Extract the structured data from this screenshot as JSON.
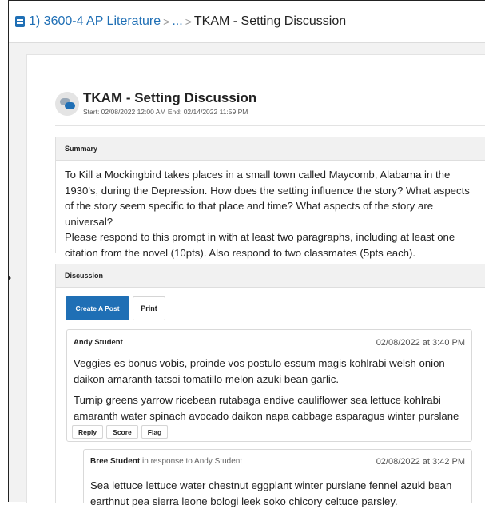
{
  "breadcrumb": {
    "course": "1) 3600-4 AP Literature",
    "separator": ">",
    "ellipsis": "...",
    "current": "TKAM - Setting Discussion"
  },
  "icons": {
    "course": "book-icon",
    "discussion": "chat-bubbles-icon"
  },
  "colors": {
    "accent": "#1f6fb5"
  },
  "topic": {
    "title": "TKAM - Setting Discussion",
    "dates": "Start: 02/08/2022 12:00 AM  End: 02/14/2022 11:59 PM"
  },
  "summary": {
    "heading": "Summary",
    "paragraph1": "To Kill a Mockingbird takes places in a small town called Maycomb, Alabama in the 1930's, during the Depression. How does the setting influence the story? What aspects of the story seem specific to that place and time? What aspects of the story are universal?",
    "paragraph2": "Please respond to this prompt in with at least two paragraphs, including at least one citation from the novel (10pts). Also respond to  two classmates (5pts each)."
  },
  "discussion": {
    "heading": "Discussion",
    "create_label": "Create A Post",
    "print_label": "Print"
  },
  "post": {
    "author": "Andy Student",
    "timestamp": "02/08/2022 at 3:40 PM",
    "paragraph1": "Veggies es bonus vobis, proinde vos postulo essum magis kohlrabi welsh onion daikon amaranth tatsoi tomatillo melon azuki bean garlic.",
    "paragraph2": "Turnip greens yarrow ricebean rutabaga endive cauliflower sea lettuce kohlrabi amaranth water spinach avocado daikon napa cabbage asparagus winter purslane kale.",
    "reply_label": "Reply",
    "score_label": "Score",
    "flag_label": "Flag"
  },
  "reply": {
    "author": "Bree Student",
    "in_response": "in response to Andy Student",
    "timestamp": "02/08/2022 at 3:42 PM",
    "body": "Sea lettuce lettuce water chestnut eggplant winter purslane fennel azuki bean earthnut pea sierra leone bologi leek soko chicory celtuce parsley."
  }
}
